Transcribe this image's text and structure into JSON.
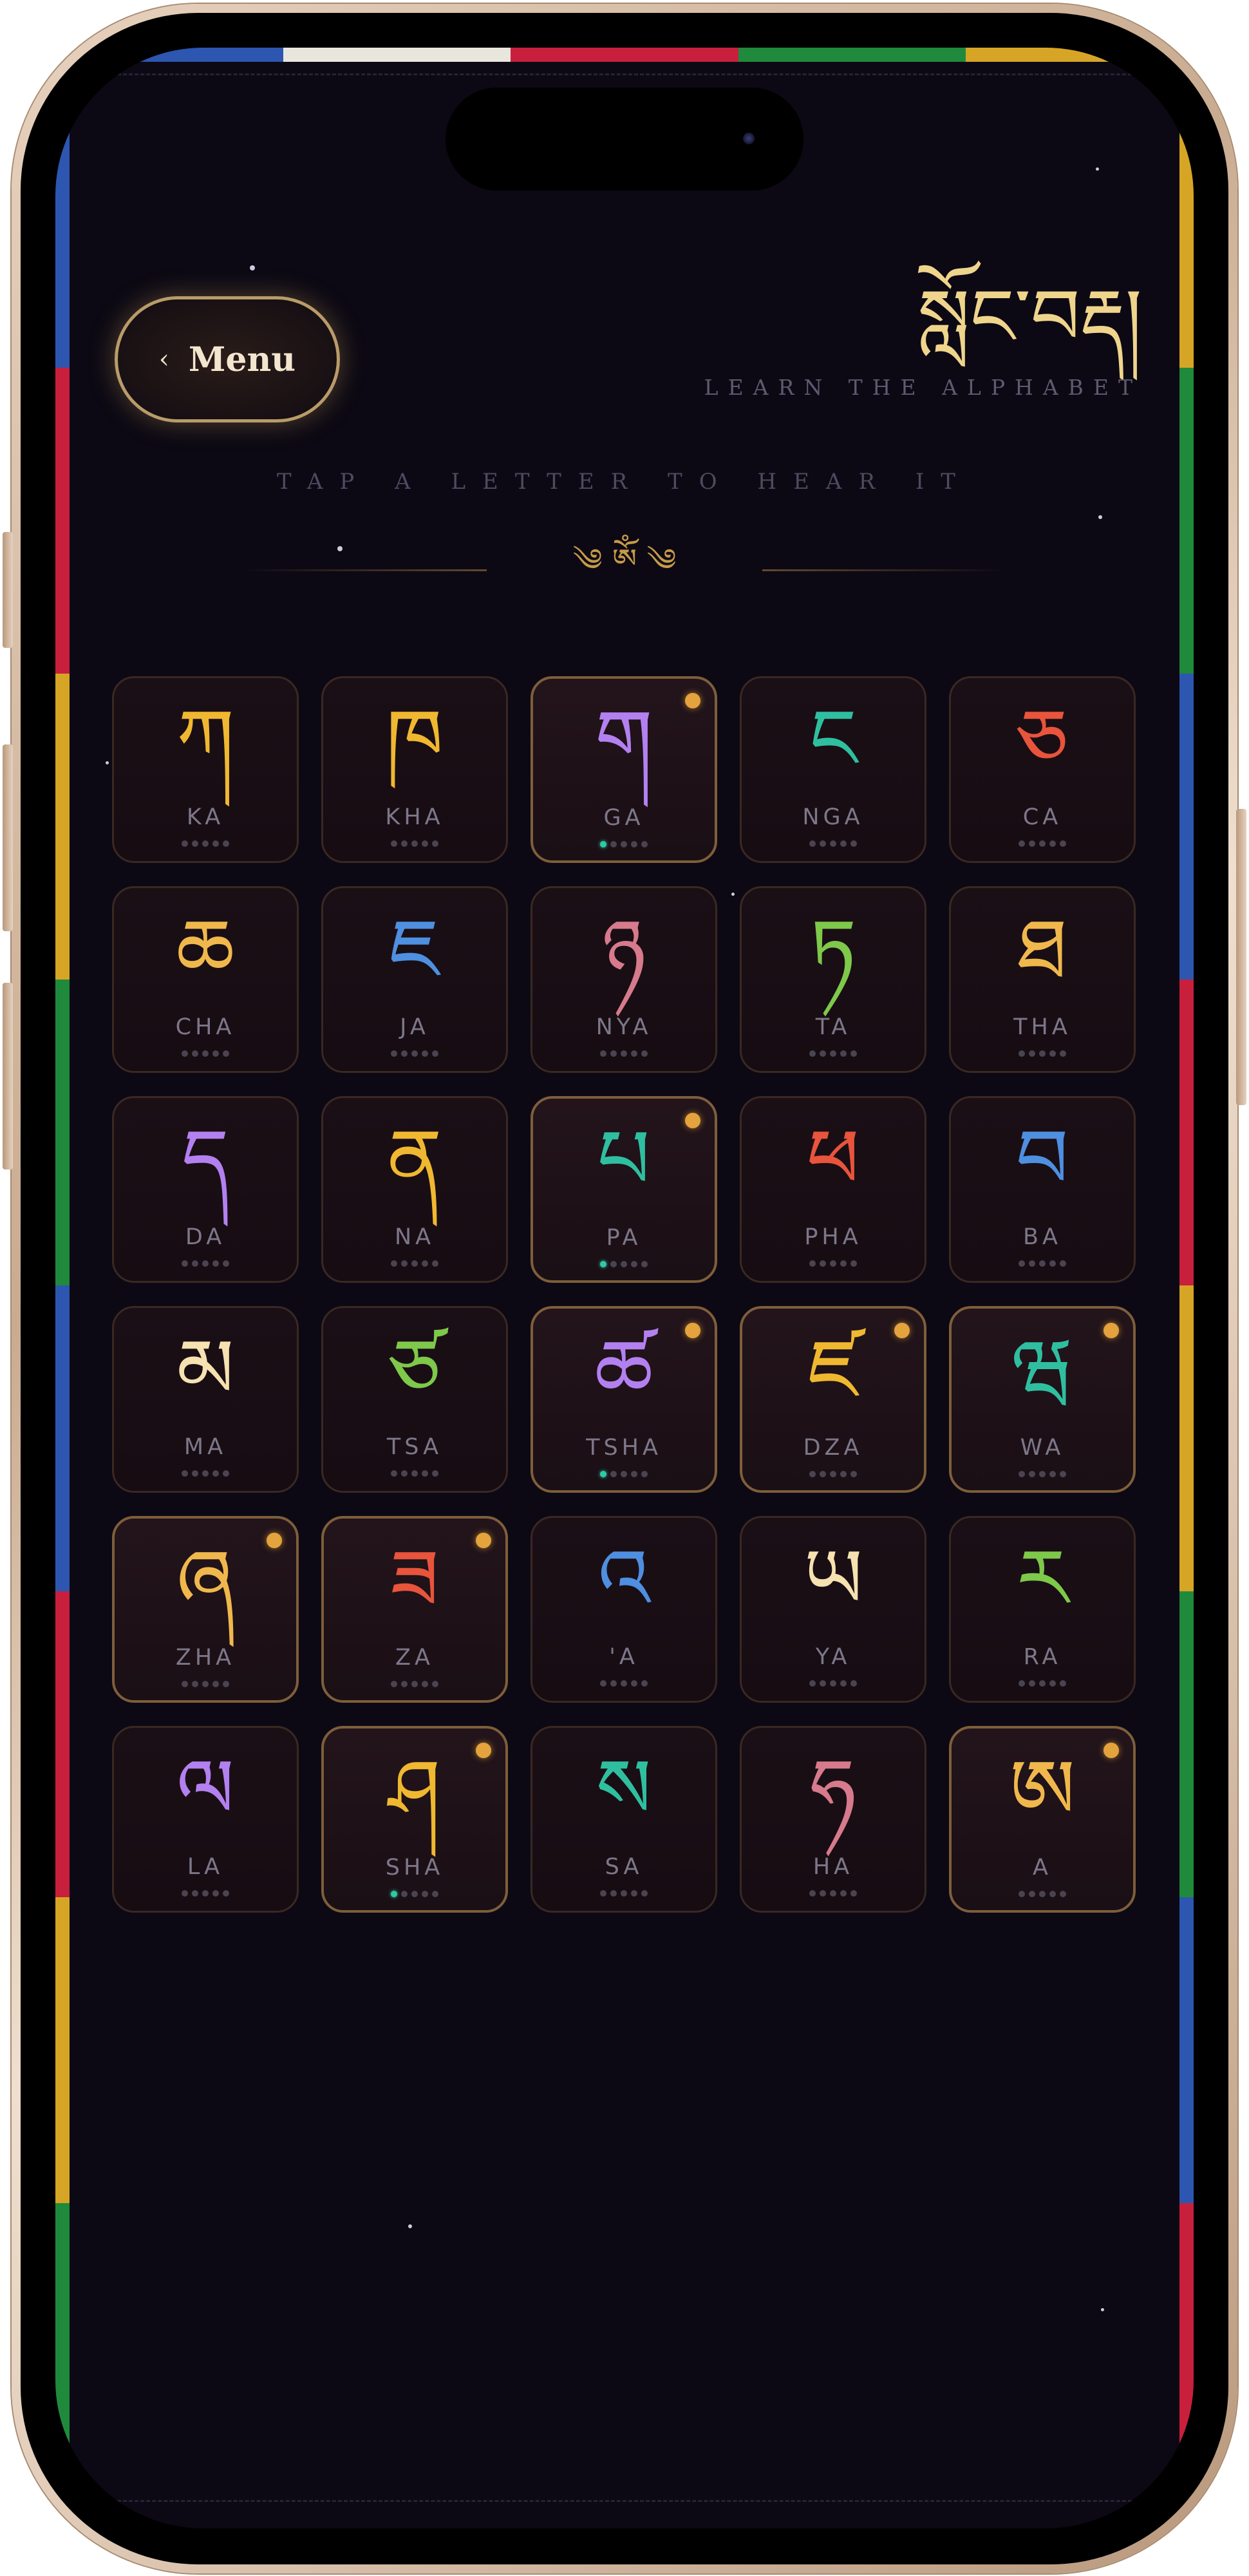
{
  "header": {
    "menu_label": "Menu",
    "menu_chevron": "‹",
    "title_tibetan": "སློང་བརྡ།",
    "title_subtitle": "LEARN THE ALPHABET"
  },
  "hint": "TAP A LETTER TO HEAR IT",
  "ornament": "༄ ༀ ༄",
  "prayer_flag_colors": [
    "#2d56b0",
    "#e9e6de",
    "#c8203c",
    "#1f8a3c",
    "#d7a526"
  ],
  "colors": {
    "background": "#0c0914",
    "gold": "#efd48c",
    "progress_active": "#2fc9a8",
    "badge": "#e4a33c"
  },
  "letters": [
    {
      "tibetan": "ཀ",
      "roman": "KA",
      "color": "#f0b830",
      "progress": 0,
      "highlighted": false
    },
    {
      "tibetan": "ཁ",
      "roman": "KHA",
      "color": "#f0b830",
      "progress": 0,
      "highlighted": false
    },
    {
      "tibetan": "ག",
      "roman": "GA",
      "color": "#b380f0",
      "progress": 1,
      "highlighted": true
    },
    {
      "tibetan": "ང",
      "roman": "NGA",
      "color": "#2fbfa0",
      "progress": 0,
      "highlighted": false
    },
    {
      "tibetan": "ཅ",
      "roman": "CA",
      "color": "#e8543c",
      "progress": 0,
      "highlighted": false
    },
    {
      "tibetan": "ཆ",
      "roman": "CHA",
      "color": "#f0b84c",
      "progress": 0,
      "highlighted": false
    },
    {
      "tibetan": "ཇ",
      "roman": "JA",
      "color": "#4e8fe0",
      "progress": 0,
      "highlighted": false
    },
    {
      "tibetan": "ཉ",
      "roman": "NYA",
      "color": "#d67a8c",
      "progress": 0,
      "highlighted": false
    },
    {
      "tibetan": "ཏ",
      "roman": "TA",
      "color": "#7ec84a",
      "progress": 0,
      "highlighted": false
    },
    {
      "tibetan": "ཐ",
      "roman": "THA",
      "color": "#f0b84c",
      "progress": 0,
      "highlighted": false
    },
    {
      "tibetan": "ད",
      "roman": "DA",
      "color": "#b380f0",
      "progress": 0,
      "highlighted": false
    },
    {
      "tibetan": "ན",
      "roman": "NA",
      "color": "#f0b830",
      "progress": 0,
      "highlighted": false
    },
    {
      "tibetan": "པ",
      "roman": "PA",
      "color": "#2fbfa0",
      "progress": 1,
      "highlighted": true
    },
    {
      "tibetan": "ཕ",
      "roman": "PHA",
      "color": "#e8543c",
      "progress": 0,
      "highlighted": false
    },
    {
      "tibetan": "བ",
      "roman": "BA",
      "color": "#4e8fe0",
      "progress": 0,
      "highlighted": false
    },
    {
      "tibetan": "མ",
      "roman": "MA",
      "color": "#f5e2b0",
      "progress": 0,
      "highlighted": false
    },
    {
      "tibetan": "ཙ",
      "roman": "TSA",
      "color": "#7ec84a",
      "progress": 0,
      "highlighted": false
    },
    {
      "tibetan": "ཚ",
      "roman": "TSHA",
      "color": "#b380f0",
      "progress": 1,
      "highlighted": true
    },
    {
      "tibetan": "ཛ",
      "roman": "DZA",
      "color": "#f0b830",
      "progress": 0,
      "highlighted": true
    },
    {
      "tibetan": "ཝ",
      "roman": "WA",
      "color": "#2fbfa0",
      "progress": 0,
      "highlighted": true
    },
    {
      "tibetan": "ཞ",
      "roman": "ZHA",
      "color": "#f0b84c",
      "progress": 0,
      "highlighted": true
    },
    {
      "tibetan": "ཟ",
      "roman": "ZA",
      "color": "#e8543c",
      "progress": 0,
      "highlighted": true
    },
    {
      "tibetan": "འ",
      "roman": "'A",
      "color": "#4e8fe0",
      "progress": 0,
      "highlighted": false
    },
    {
      "tibetan": "ཡ",
      "roman": "YA",
      "color": "#f5e2b0",
      "progress": 0,
      "highlighted": false
    },
    {
      "tibetan": "ར",
      "roman": "RA",
      "color": "#7ec84a",
      "progress": 0,
      "highlighted": false
    },
    {
      "tibetan": "ལ",
      "roman": "LA",
      "color": "#b380f0",
      "progress": 0,
      "highlighted": false
    },
    {
      "tibetan": "ཤ",
      "roman": "SHA",
      "color": "#f0b830",
      "progress": 1,
      "highlighted": true
    },
    {
      "tibetan": "ས",
      "roman": "SA",
      "color": "#2fbfa0",
      "progress": 0,
      "highlighted": false
    },
    {
      "tibetan": "ཧ",
      "roman": "HA",
      "color": "#d67a8c",
      "progress": 0,
      "highlighted": false
    },
    {
      "tibetan": "ཨ",
      "roman": "A",
      "color": "#f0b84c",
      "progress": 0,
      "highlighted": true
    }
  ]
}
